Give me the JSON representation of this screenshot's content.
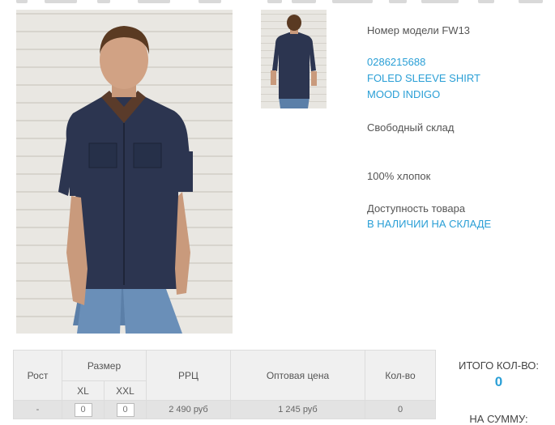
{
  "product": {
    "model_label": "Номер модели FW13",
    "article": "0286215688",
    "name_line1": "FOLED SLEEVE SHIRT",
    "name_line2": "MOOD INDIGO",
    "warehouse": "Свободный склад",
    "material": "100% хлопок",
    "availability_label": "Доступность товара",
    "availability_status": "В НАЛИЧИИ НА СКЛАДЕ"
  },
  "table": {
    "headers": {
      "height": "Рост",
      "size": "Размер",
      "sizes": [
        "XL",
        "XXL"
      ],
      "rrp": "РРЦ",
      "wholesale": "Оптовая цена",
      "qty": "Кол-во"
    },
    "row": {
      "height": "-",
      "qty_xl": "0",
      "qty_xxl": "0",
      "rrp": "2 490 руб",
      "wholesale": "1 245 руб",
      "qty": "0"
    }
  },
  "totals": {
    "qty_label": "ИТОГО КОЛ-ВО:",
    "qty_value": "0",
    "sum_label": "НА СУММУ:"
  },
  "colors": {
    "accent": "#2a9fd6",
    "text": "#555555",
    "table_header_bg": "#f0f0f0",
    "table_row_bg": "#e3e3e3"
  }
}
